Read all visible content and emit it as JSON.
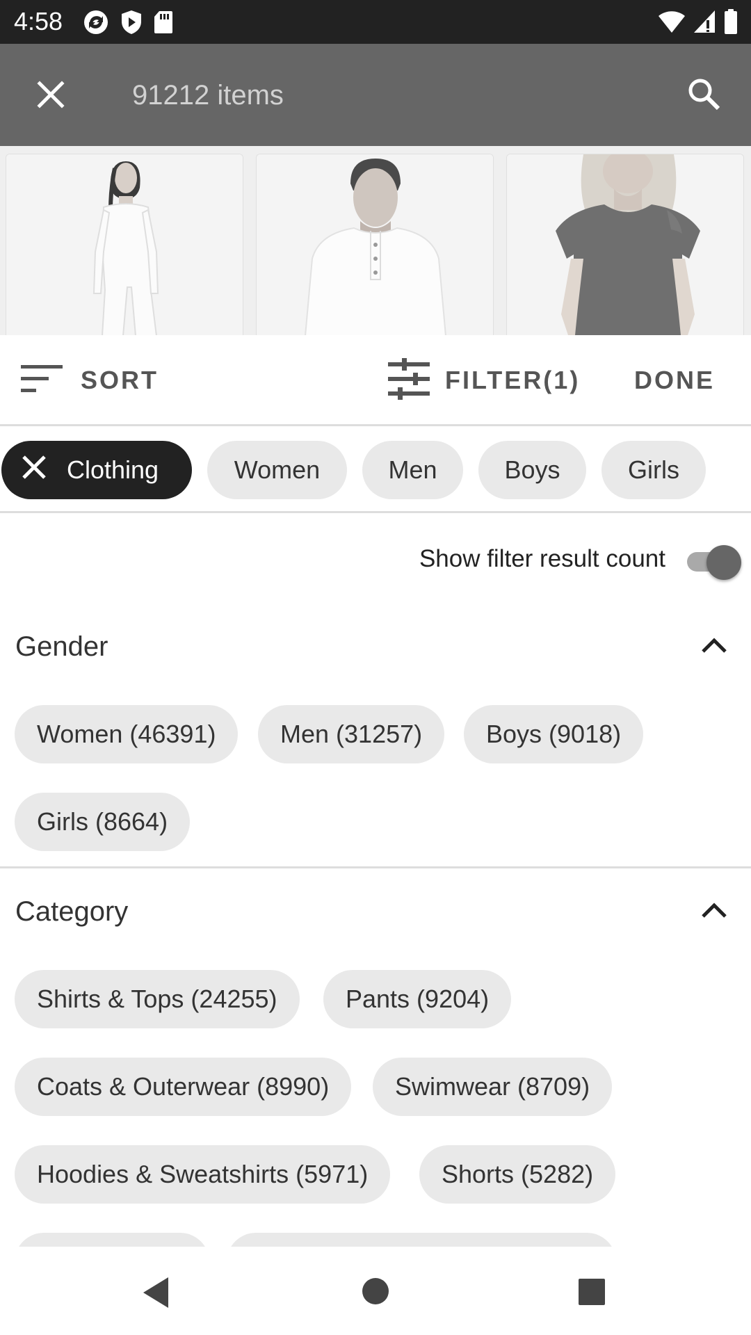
{
  "status_bar": {
    "time": "4:58",
    "left_icons": [
      "sync-icon",
      "play-shield-icon",
      "sd-card-icon"
    ],
    "right_icons": [
      "wifi-icon",
      "cellular-signal-icon",
      "battery-icon"
    ]
  },
  "app_bar": {
    "items_count": "91212 items",
    "close_icon": "close-icon",
    "search_icon": "search-icon"
  },
  "products": [
    {
      "name": "product-image-women-bodysuit"
    },
    {
      "name": "product-image-men-henley"
    },
    {
      "name": "product-image-women-tee"
    }
  ],
  "toolbar": {
    "sort_label": "SORT",
    "filter_label": "FILTER(1)",
    "done_label": "DONE"
  },
  "applied_chips": {
    "selected": "Clothing",
    "others": [
      "Women",
      "Men",
      "Boys",
      "Girls"
    ]
  },
  "toggle": {
    "label": "Show filter result count",
    "on": true
  },
  "gender": {
    "title": "Gender",
    "options": [
      "Women (46391)",
      "Men (31257)",
      "Boys (9018)",
      "Girls (8664)"
    ]
  },
  "category": {
    "title": "Category",
    "options": [
      "Shirts & Tops (24255)",
      "Pants (9204)",
      "Coats & Outerwear (8990)",
      "Swimwear (8709)",
      "Hoodies & Sweatshirts (5971)",
      "Shorts (5282)"
    ]
  },
  "nav_bar": {
    "icons": [
      "back-icon",
      "home-icon",
      "recents-icon"
    ]
  }
}
